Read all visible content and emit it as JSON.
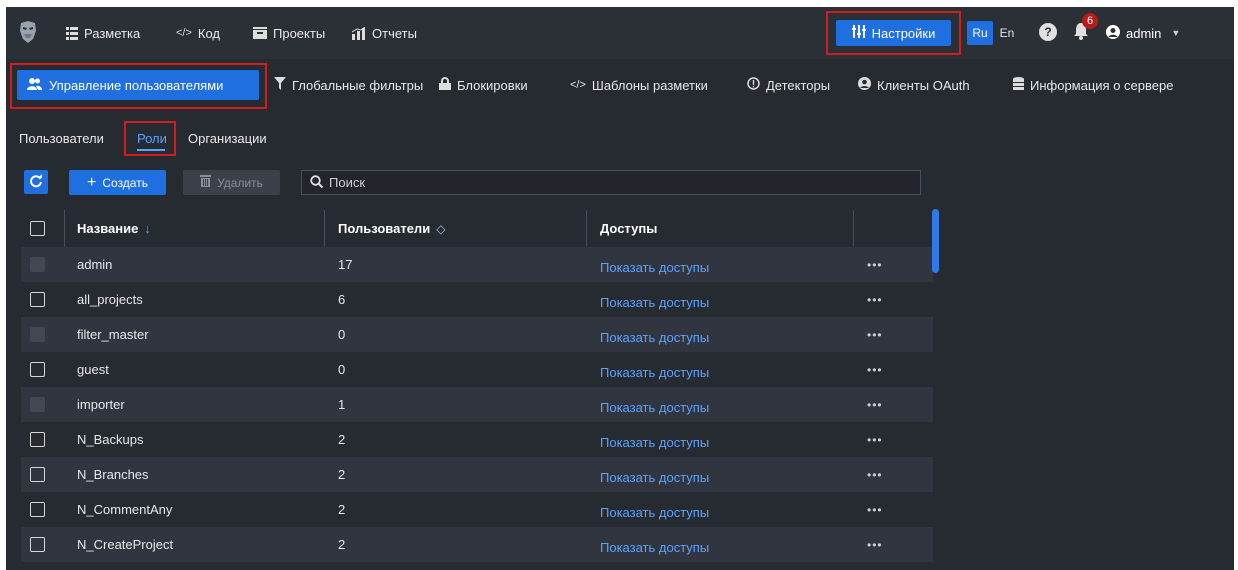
{
  "topnav": {
    "items": [
      {
        "label": "Разметка",
        "icon": "list-bars-icon"
      },
      {
        "label": "Код",
        "icon": "code-icon"
      },
      {
        "label": "Проекты",
        "icon": "folder-icon"
      },
      {
        "label": "Отчеты",
        "icon": "chart-icon"
      }
    ],
    "settings_label": "Настройки",
    "lang_ru": "Ru",
    "lang_en": "En",
    "notifications_count": "6",
    "user_name": "admin"
  },
  "subnav": {
    "items": [
      {
        "label": "Управление пользователями",
        "icon": "users-icon"
      },
      {
        "label": "Глобальные фильтры",
        "icon": "filter-icon"
      },
      {
        "label": "Блокировки",
        "icon": "lock-icon"
      },
      {
        "label": "Шаблоны разметки",
        "icon": "code-icon"
      },
      {
        "label": "Детекторы",
        "icon": "alert-circle-icon"
      },
      {
        "label": "Клиенты OAuth",
        "icon": "user-circle-icon"
      },
      {
        "label": "Информация о сервере",
        "icon": "database-icon"
      }
    ]
  },
  "tabs": {
    "users": "Пользователи",
    "roles": "Роли",
    "orgs": "Организации"
  },
  "toolbar": {
    "create_label": "Создать",
    "delete_label": "Удалить",
    "search_placeholder": "Поиск"
  },
  "table": {
    "headers": {
      "name": "Название",
      "users": "Пользователи",
      "access": "Доступы"
    },
    "rows": [
      {
        "name": "admin",
        "users": "17",
        "access": "Показать доступы",
        "disabled": true
      },
      {
        "name": "all_projects",
        "users": "6",
        "access": "Показать доступы",
        "disabled": false
      },
      {
        "name": "filter_master",
        "users": "0",
        "access": "Показать доступы",
        "disabled": true
      },
      {
        "name": "guest",
        "users": "0",
        "access": "Показать доступы",
        "disabled": false
      },
      {
        "name": "importer",
        "users": "1",
        "access": "Показать доступы",
        "disabled": true
      },
      {
        "name": "N_Backups",
        "users": "2",
        "access": "Показать доступы",
        "disabled": false
      },
      {
        "name": "N_Branches",
        "users": "2",
        "access": "Показать доступы",
        "disabled": false
      },
      {
        "name": "N_CommentAny",
        "users": "2",
        "access": "Показать доступы",
        "disabled": false
      },
      {
        "name": "N_CreateProject",
        "users": "2",
        "access": "Показать доступы",
        "disabled": false
      }
    ],
    "more_label": "•••"
  },
  "colors": {
    "accent": "#1f6fe0",
    "link": "#5aa3ff",
    "highlight_border": "#d01e1e",
    "badge": "#b71c1c"
  }
}
